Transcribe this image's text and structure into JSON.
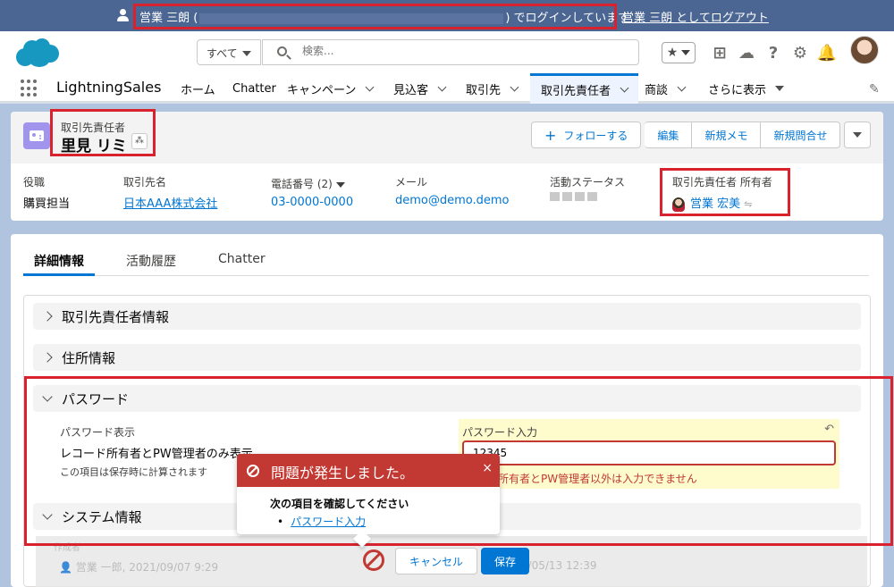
{
  "impersonation": {
    "user": "営業 三朗 (",
    "suffix": ") でログインしています",
    "logout": "営業 三朗 としてログアウト"
  },
  "header": {
    "search_scope": "すべて",
    "search_placeholder": "検索..."
  },
  "nav": {
    "app_name": "LightningSales",
    "items": [
      {
        "label": "ホーム"
      },
      {
        "label": "Chatter"
      },
      {
        "label": "キャンペーン"
      },
      {
        "label": "見込客"
      },
      {
        "label": "取引先"
      },
      {
        "label": "取引先責任者"
      },
      {
        "label": "商談"
      },
      {
        "label": "さらに表示"
      }
    ]
  },
  "record": {
    "type": "取引先責任者",
    "name": "里見 リミ",
    "buttons": {
      "follow": "フォローする",
      "edit": "編集",
      "new_memo": "新規メモ",
      "new_case": "新規問合せ"
    },
    "fields": [
      {
        "label": "役職",
        "value": "購買担当"
      },
      {
        "label": "取引先名",
        "value": "日本AAA株式会社"
      },
      {
        "label": "電話番号 (2)",
        "value": "03-0000-0000"
      },
      {
        "label": "メール",
        "value": "demo@demo.demo"
      },
      {
        "label": "活動ステータス",
        "value": ""
      },
      {
        "label": "取引先責任者 所有者",
        "value": "営業 宏美"
      }
    ]
  },
  "detail": {
    "tabs": [
      "詳細情報",
      "活動履歴",
      "Chatter"
    ],
    "sections": {
      "contact_info": "取引先責任者情報",
      "address": "住所情報",
      "password": "パスワード",
      "system": "システム情報"
    },
    "pw_display": {
      "label": "パスワード表示",
      "value": "レコード所有者とPW管理者のみ表示",
      "help": "この項目は保存時に計算されます"
    },
    "pw_input": {
      "label": "パスワード入力",
      "value": "12345",
      "error": "所有者とPW管理者以外は入力できません"
    }
  },
  "footer": {
    "created_label": "作成者",
    "created_by": "営業 一郎, 2021/09/07 9:29",
    "modified": "2022/05/13 12:39",
    "cancel": "キャンセル",
    "save": "保存"
  },
  "error_popover": {
    "title": "問題が発生しました。",
    "close": "×",
    "check": "次の項目を確認してください",
    "field": "パスワード入力"
  }
}
